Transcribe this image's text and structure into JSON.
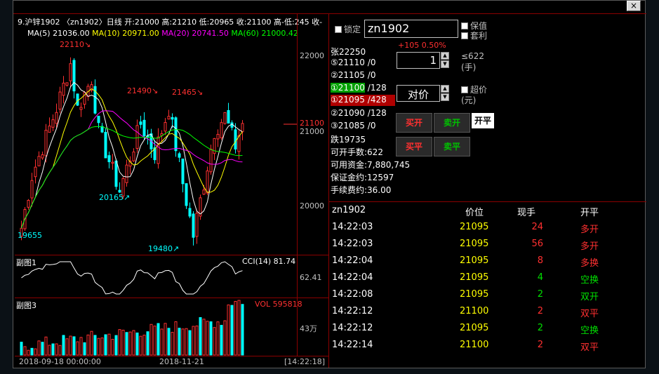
{
  "window": {
    "close_glyph": "×"
  },
  "chart_header": {
    "symbol_line": "9.沪锌1902 〈zn1902〉日线 开:21000 高:21210 低:20965 收:21100 高-低:245 收-",
    "ma": [
      {
        "label": "MA(5)",
        "value": "21036.00",
        "color": "#ffffff"
      },
      {
        "label": "MA(10)",
        "value": "20971.00",
        "color": "#ffff00"
      },
      {
        "label": "MA(20)",
        "value": "20741.50",
        "color": "#ff00ff"
      },
      {
        "label": "MA(60)",
        "value": "21000.42",
        "color": "#00ff00"
      }
    ]
  },
  "main_axis": {
    "ticks": [
      "22000",
      "21100",
      "21000",
      "20000"
    ],
    "current": "21100"
  },
  "annotations": {
    "high1": "22110↘",
    "high2": "21490↘",
    "high3": "21465↘",
    "low1": "19655",
    "low2": "20165↗",
    "low3": "19480↗"
  },
  "sub1": {
    "title": "副图1",
    "indicator": "CCI(14) 81.74",
    "axis": "62.41"
  },
  "sub3": {
    "title": "副图3",
    "indicator": "VOL 595818",
    "axis": "43万"
  },
  "time_axis": {
    "start": "2018-09-18 00:00:00",
    "mid": "2018-11-21",
    "clock": "[14:22:18]"
  },
  "order_panel": {
    "lock_label": "锁定",
    "symbol_input": "zn1902",
    "keep_label": "保值",
    "arb_label": "套利",
    "limit_up": "张22250",
    "change": "+105 0.50%",
    "qty": "1",
    "max_qty": "≤622",
    "qty_unit": "(手)",
    "price_mode": "对价",
    "super_label": "超价",
    "price_unit": "(元)",
    "asks": [
      {
        "level": "⑤",
        "price": "21110",
        "vol": "/0"
      },
      {
        "level": "②",
        "price": "21105",
        "vol": "/0"
      },
      {
        "level": "①",
        "price": "21100",
        "vol": "/128"
      }
    ],
    "bids": [
      {
        "level": "①",
        "price": "21095",
        "vol": "/428"
      },
      {
        "level": "②",
        "price": "21090",
        "vol": "/128"
      },
      {
        "level": "③",
        "price": "21085",
        "vol": "/0"
      }
    ],
    "limit_down": "跌19735",
    "buttons": {
      "buy_open": "买开",
      "sell_open": "卖开",
      "close_all": "开平",
      "buy_close": "买平",
      "sell_close": "卖平"
    },
    "account": [
      "可开手数:622",
      "可用资金:7,880,745",
      "保证金约:12597",
      "手续费约:36.00"
    ]
  },
  "trades": {
    "headers": {
      "symbol": "zn1902",
      "price": "价位",
      "qty": "现手",
      "type": "开平"
    },
    "rows": [
      {
        "time": "14:22:03",
        "price": "21095",
        "qty": "24",
        "type": "多开",
        "qcolor": "#ff3030",
        "tcolor": "#ff3030"
      },
      {
        "time": "14:22:03",
        "price": "21095",
        "qty": "56",
        "type": "多开",
        "qcolor": "#ff3030",
        "tcolor": "#ff3030"
      },
      {
        "time": "14:22:04",
        "price": "21095",
        "qty": "8",
        "type": "多换",
        "qcolor": "#ff3030",
        "tcolor": "#ff3030"
      },
      {
        "time": "14:22:04",
        "price": "21095",
        "qty": "4",
        "type": "空换",
        "qcolor": "#00e000",
        "tcolor": "#00e000"
      },
      {
        "time": "14:22:08",
        "price": "21095",
        "qty": "2",
        "type": "双开",
        "qcolor": "#00e000",
        "tcolor": "#00e000"
      },
      {
        "time": "14:22:12",
        "price": "21100",
        "qty": "2",
        "type": "双平",
        "qcolor": "#ff3030",
        "tcolor": "#ff3030"
      },
      {
        "time": "14:22:12",
        "price": "21095",
        "qty": "2",
        "type": "空换",
        "qcolor": "#00e000",
        "tcolor": "#00e000"
      },
      {
        "time": "14:22:14",
        "price": "21100",
        "qty": "2",
        "type": "双平",
        "qcolor": "#ff3030",
        "tcolor": "#ff3030"
      }
    ]
  },
  "colors": {
    "up": "#ff3030",
    "down": "#00ffff",
    "price_yellow": "#ffff00"
  }
}
